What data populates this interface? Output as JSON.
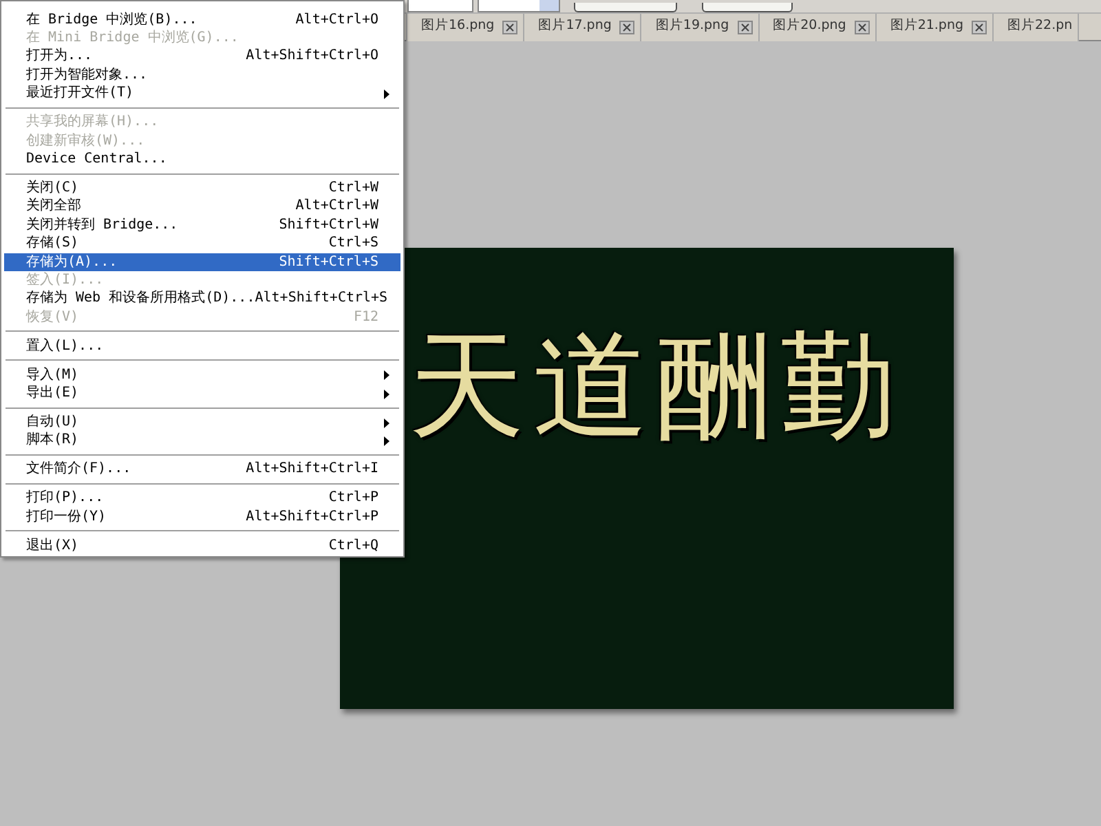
{
  "tabs": [
    {
      "label": "图片16.png"
    },
    {
      "label": "图片17.png"
    },
    {
      "label": "图片19.png"
    },
    {
      "label": "图片20.png"
    },
    {
      "label": "图片21.png"
    },
    {
      "label": "图片22.pn"
    }
  ],
  "menu": {
    "items": [
      {
        "kind": "item",
        "label": "在 Bridge 中浏览(B)...",
        "shortcut": "Alt+Ctrl+O",
        "disabled": false,
        "selected": false
      },
      {
        "kind": "item",
        "label": "在 Mini Bridge 中浏览(G)...",
        "disabled": true,
        "selected": false
      },
      {
        "kind": "item",
        "label": "打开为...",
        "shortcut": "Alt+Shift+Ctrl+O",
        "disabled": false,
        "selected": false
      },
      {
        "kind": "item",
        "label": "打开为智能对象...",
        "disabled": false,
        "selected": false
      },
      {
        "kind": "submenu",
        "label": "最近打开文件(T)",
        "disabled": false,
        "selected": false
      },
      {
        "kind": "separator"
      },
      {
        "kind": "item",
        "label": "共享我的屏幕(H)...",
        "disabled": true,
        "selected": false
      },
      {
        "kind": "item",
        "label": "创建新审核(W)...",
        "disabled": true,
        "selected": false
      },
      {
        "kind": "item",
        "label": "Device Central...",
        "disabled": false,
        "selected": false
      },
      {
        "kind": "separator"
      },
      {
        "kind": "item",
        "label": "关闭(C)",
        "shortcut": "Ctrl+W",
        "disabled": false,
        "selected": false
      },
      {
        "kind": "item",
        "label": "关闭全部",
        "shortcut": "Alt+Ctrl+W",
        "disabled": false,
        "selected": false
      },
      {
        "kind": "item",
        "label": "关闭并转到 Bridge...",
        "shortcut": "Shift+Ctrl+W",
        "disabled": false,
        "selected": false
      },
      {
        "kind": "item",
        "label": "存储(S)",
        "shortcut": "Ctrl+S",
        "disabled": false,
        "selected": false
      },
      {
        "kind": "item",
        "label": "存储为(A)...",
        "shortcut": "Shift+Ctrl+S",
        "disabled": false,
        "selected": true
      },
      {
        "kind": "item",
        "label": "签入(I)...",
        "disabled": true,
        "selected": false
      },
      {
        "kind": "item",
        "label": "存储为 Web 和设备所用格式(D)...",
        "shortcut": "Alt+Shift+Ctrl+S",
        "disabled": false,
        "selected": false
      },
      {
        "kind": "item",
        "label": "恢复(V)",
        "shortcut": "F12",
        "disabled": true,
        "selected": false
      },
      {
        "kind": "separator"
      },
      {
        "kind": "item",
        "label": "置入(L)...",
        "disabled": false,
        "selected": false
      },
      {
        "kind": "separator"
      },
      {
        "kind": "submenu",
        "label": "导入(M)",
        "disabled": false,
        "selected": false
      },
      {
        "kind": "submenu",
        "label": "导出(E)",
        "disabled": false,
        "selected": false
      },
      {
        "kind": "separator"
      },
      {
        "kind": "submenu",
        "label": "自动(U)",
        "disabled": false,
        "selected": false
      },
      {
        "kind": "submenu",
        "label": "脚本(R)",
        "disabled": false,
        "selected": false
      },
      {
        "kind": "separator"
      },
      {
        "kind": "item",
        "label": "文件简介(F)...",
        "shortcut": "Alt+Shift+Ctrl+I",
        "disabled": false,
        "selected": false
      },
      {
        "kind": "separator"
      },
      {
        "kind": "item",
        "label": "打印(P)...",
        "shortcut": "Ctrl+P",
        "disabled": false,
        "selected": false
      },
      {
        "kind": "item",
        "label": "打印一份(Y)",
        "shortcut": "Alt+Shift+Ctrl+P",
        "disabled": false,
        "selected": false
      },
      {
        "kind": "separator"
      },
      {
        "kind": "item",
        "label": "退出(X)",
        "shortcut": "Ctrl+Q",
        "disabled": false,
        "selected": false
      }
    ]
  },
  "canvas": {
    "text": "天道酬勤"
  }
}
